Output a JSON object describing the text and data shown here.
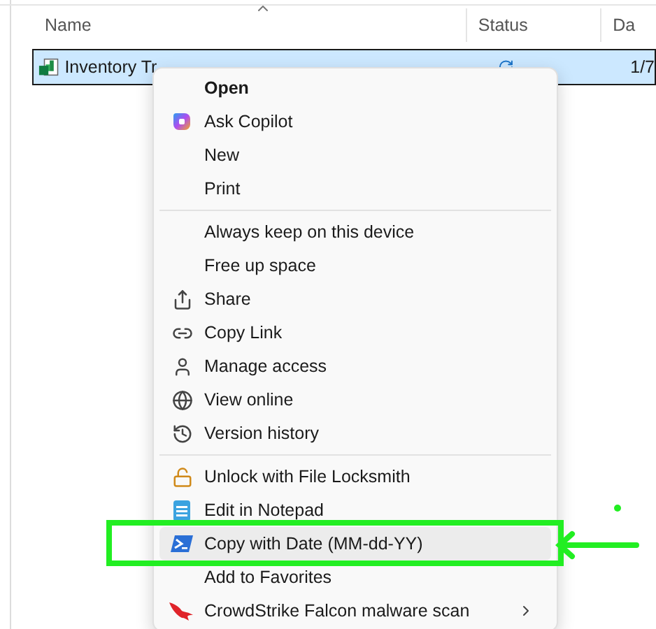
{
  "columns": [
    {
      "label": "Name"
    },
    {
      "label": "Status"
    },
    {
      "label": "Da"
    }
  ],
  "file_row": {
    "name": "Inventory Tr",
    "date": "1/7",
    "selected": true
  },
  "context_menu": {
    "groups": [
      [
        {
          "label": "Open",
          "default": true,
          "selected": false,
          "submenu": false
        },
        {
          "label": "Ask Copilot",
          "default": false,
          "selected": false,
          "submenu": false
        },
        {
          "label": "New",
          "default": false,
          "selected": false,
          "submenu": false
        },
        {
          "label": "Print",
          "default": false,
          "selected": false,
          "submenu": false
        }
      ],
      [
        {
          "label": "Always keep on this device",
          "default": false,
          "selected": false,
          "submenu": false
        },
        {
          "label": "Free up space",
          "default": false,
          "selected": false,
          "submenu": false
        },
        {
          "label": "Share",
          "default": false,
          "selected": false,
          "submenu": false
        },
        {
          "label": "Copy Link",
          "default": false,
          "selected": false,
          "submenu": false
        },
        {
          "label": "Manage access",
          "default": false,
          "selected": false,
          "submenu": false
        },
        {
          "label": "View online",
          "default": false,
          "selected": false,
          "submenu": false
        },
        {
          "label": "Version history",
          "default": false,
          "selected": false,
          "submenu": false
        }
      ],
      [
        {
          "label": "Unlock with File Locksmith",
          "default": false,
          "selected": false,
          "submenu": false
        },
        {
          "label": "Edit in Notepad",
          "default": false,
          "selected": false,
          "submenu": false
        },
        {
          "label": "Copy with Date (MM-dd-YY)",
          "default": false,
          "selected": true,
          "submenu": false
        },
        {
          "label": "Add to Favorites",
          "default": false,
          "selected": false,
          "submenu": false
        },
        {
          "label": "CrowdStrike Falcon malware scan",
          "default": false,
          "selected": false,
          "submenu": true
        }
      ]
    ]
  }
}
